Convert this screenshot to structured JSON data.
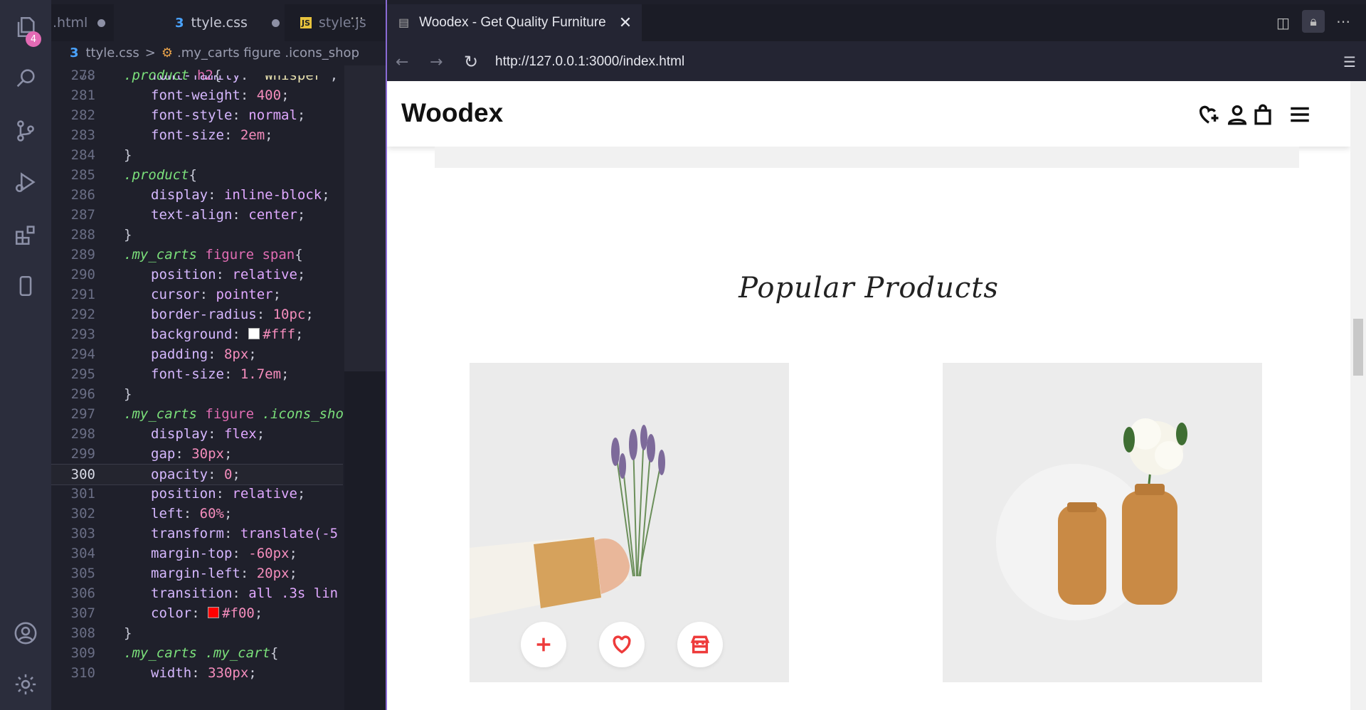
{
  "activity_bar": {
    "explorer_badge": "4",
    "icons": [
      "files-icon",
      "search-icon",
      "source-control-icon",
      "run-debug-icon",
      "extensions-icon",
      "mobile-preview-icon",
      "account-icon",
      "settings-gear-icon"
    ]
  },
  "editor": {
    "tabs": [
      {
        "label": ".html",
        "dirty": true
      },
      {
        "label": "ttyle.css",
        "dirty": true,
        "active": true
      },
      {
        "label": "style.js",
        "dirty": false
      }
    ],
    "more_label": "···",
    "breadcrumb": {
      "file": "ttyle.css",
      "separator": ">",
      "symbol": ".my_carts figure .icons_shop"
    },
    "current_line": "300",
    "lines": [
      {
        "n": "278"
      },
      {
        "n": "280"
      },
      {
        "n": "281"
      },
      {
        "n": "282"
      },
      {
        "n": "283"
      },
      {
        "n": "284"
      },
      {
        "n": "285"
      },
      {
        "n": "286"
      },
      {
        "n": "287"
      },
      {
        "n": "288"
      },
      {
        "n": "289"
      },
      {
        "n": "290"
      },
      {
        "n": "291"
      },
      {
        "n": "292"
      },
      {
        "n": "293"
      },
      {
        "n": "294"
      },
      {
        "n": "295"
      },
      {
        "n": "296"
      },
      {
        "n": "297"
      },
      {
        "n": "298"
      },
      {
        "n": "299"
      },
      {
        "n": "300"
      },
      {
        "n": "301"
      },
      {
        "n": "302"
      },
      {
        "n": "303"
      },
      {
        "n": "304"
      },
      {
        "n": "305"
      },
      {
        "n": "306"
      },
      {
        "n": "307"
      },
      {
        "n": "308"
      },
      {
        "n": "309"
      },
      {
        "n": "310"
      }
    ],
    "code": {
      "l278_sel": ".product",
      "l278_tag": "h2",
      "l278_b": "{",
      "l280_prop": "font-family",
      "l280_val": "\"Whisper\"",
      "l281_prop": "font-weight",
      "l281_val": "400",
      "l282_prop": "font-style",
      "l282_val": "normal",
      "l283_prop": "font-size",
      "l283_val": "2em",
      "close": "}",
      "l285_sel": ".product",
      "l285_b": "{",
      "l286_prop": "display",
      "l286_val": "inline-block",
      "l287_prop": "text-align",
      "l287_val": "center",
      "l289_sel": ".my_carts",
      "l289_tag": "figure span",
      "l289_b": "{",
      "l290_prop": "position",
      "l290_val": "relative",
      "l291_prop": "cursor",
      "l291_val": "pointer",
      "l292_prop": "border-radius",
      "l292_val": "10pc",
      "l293_prop": "background",
      "l293_val": "#fff",
      "l294_prop": "padding",
      "l294_val": "8px",
      "l295_prop": "font-size",
      "l295_val": "1.7em",
      "l297_sel": ".my_carts",
      "l297_tag": "figure",
      "l297_sel2": ".icons_sho",
      "l298_prop": "display",
      "l298_val": "flex",
      "l299_prop": "gap",
      "l299_val": "30px",
      "l300_prop": "opacity",
      "l300_val": "0",
      "l301_prop": "position",
      "l301_val": "relative",
      "l302_prop": "left",
      "l302_val": "60%",
      "l303_prop": "transform",
      "l303_val": "translate(-5",
      "l304_prop": "margin-top",
      "l304_val": "-60px",
      "l305_prop": "margin-left",
      "l305_val": "20px",
      "l306_prop": "transition",
      "l306_val": "all .3s lin",
      "l307_prop": "color",
      "l307_val": "#f00",
      "l309_sel": ".my_carts",
      "l309_sel2": ".my_cart",
      "l309_b": "{",
      "l310_prop": "width",
      "l310_val": "330px"
    },
    "swatches": {
      "white": "#ffffff",
      "red": "#ff0000"
    }
  },
  "browser": {
    "tab_title": "Woodex - Get Quality Furniture",
    "url": "http://127.0.0.1:3000/index.html"
  },
  "site": {
    "logo": "Woodex",
    "header_icons": [
      "wishlist-heart-plus-icon",
      "user-icon",
      "shopping-bag-icon",
      "hamburger-menu-icon"
    ],
    "section_title": "Popular Products",
    "products": [
      {
        "image": "lavender-bouquet-in-hand",
        "actions": [
          "plus-icon",
          "heart-icon",
          "store-icon"
        ]
      },
      {
        "image": "wooden-vases-with-flower"
      }
    ],
    "accent_color": "#ee3b3b"
  }
}
